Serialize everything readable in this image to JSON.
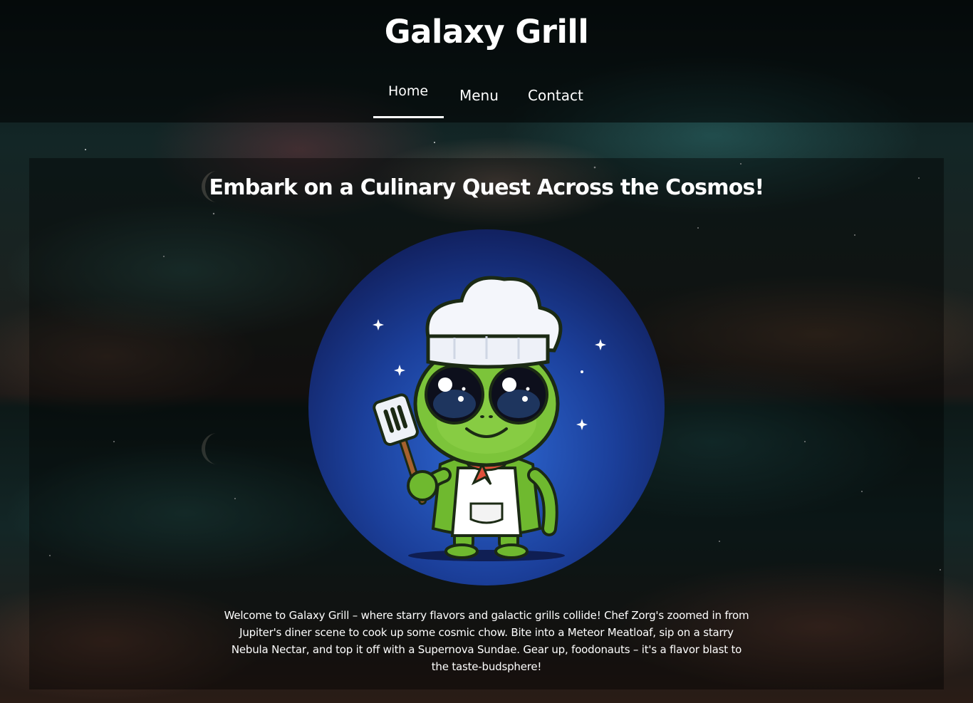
{
  "site": {
    "title": "Galaxy Grill"
  },
  "nav": {
    "items": [
      {
        "label": "Home",
        "active": true
      },
      {
        "label": "Menu",
        "active": false
      },
      {
        "label": "Contact",
        "active": false
      }
    ]
  },
  "hero": {
    "headline": "Embark on a Culinary Quest Across the Cosmos!",
    "image_icon": "alien-chef-illustration-icon",
    "welcome_text": "Welcome to Galaxy Grill – where starry flavors and galactic grills collide! Chef Zorg's zoomed in from Jupiter's diner scene to cook up some cosmic chow. Bite into a Meteor Meatloaf, sip on a starry Nebula Nectar, and top it off with a Supernova Sundae. Gear up, foodonauts – it's a flavor blast to the taste-budsphere!"
  },
  "colors": {
    "text": "#ffffff",
    "header_overlay": "#000000",
    "alien_green": "#7cc43a",
    "badge_blue": "#1b3f9a"
  }
}
